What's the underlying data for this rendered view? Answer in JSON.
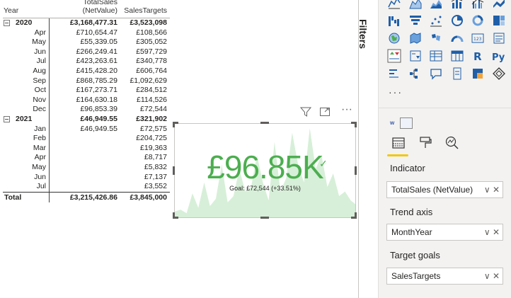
{
  "matrix": {
    "headers": [
      "Year",
      "TotalSales (NetValue)",
      "SalesTargets"
    ],
    "rows": [
      {
        "type": "year",
        "label": "2020",
        "sales": "£3,168,477.31",
        "target": "£3,523,098"
      },
      {
        "type": "month",
        "label": "Apr",
        "sales": "£710,654.47",
        "target": "£108,566"
      },
      {
        "type": "month",
        "label": "May",
        "sales": "£55,339.05",
        "target": "£305,052"
      },
      {
        "type": "month",
        "label": "Jun",
        "sales": "£266,249.41",
        "target": "£597,729"
      },
      {
        "type": "month",
        "label": "Jul",
        "sales": "£423,263.61",
        "target": "£340,778"
      },
      {
        "type": "month",
        "label": "Aug",
        "sales": "£415,428.20",
        "target": "£606,764"
      },
      {
        "type": "month",
        "label": "Sep",
        "sales": "£868,785.29",
        "target": "£1,092,629"
      },
      {
        "type": "month",
        "label": "Oct",
        "sales": "£167,273.71",
        "target": "£284,512"
      },
      {
        "type": "month",
        "label": "Nov",
        "sales": "£164,630.18",
        "target": "£114,526"
      },
      {
        "type": "month",
        "label": "Dec",
        "sales": "£96,853.39",
        "target": "£72,544"
      },
      {
        "type": "year",
        "label": "2021",
        "sales": "£46,949.55",
        "target": "£321,902"
      },
      {
        "type": "month",
        "label": "Jan",
        "sales": "£46,949.55",
        "target": "£72,575"
      },
      {
        "type": "month",
        "label": "Feb",
        "sales": "",
        "target": "£204,725"
      },
      {
        "type": "month",
        "label": "Mar",
        "sales": "",
        "target": "£19,363"
      },
      {
        "type": "month",
        "label": "Apr",
        "sales": "",
        "target": "£8,717"
      },
      {
        "type": "month",
        "label": "May",
        "sales": "",
        "target": "£5,832"
      },
      {
        "type": "month",
        "label": "Jun",
        "sales": "",
        "target": "£7,137"
      },
      {
        "type": "month",
        "label": "Jul",
        "sales": "",
        "target": "£3,552"
      }
    ],
    "total": {
      "label": "Total",
      "sales": "£3,215,426.86",
      "target": "£3,845,000"
    }
  },
  "kpi": {
    "value": "£96.85K",
    "goal": "Goal: £72,544 (+33.51%)",
    "trend": [
      8,
      10,
      6,
      28,
      12,
      40,
      14,
      22,
      60,
      18,
      25,
      55,
      30,
      35,
      70,
      40,
      20,
      85,
      30,
      45,
      95,
      60,
      40,
      100,
      55,
      70,
      35,
      50,
      25,
      30,
      20,
      15
    ],
    "accent": "#4cae4f",
    "fill": "#d7efd8"
  },
  "visual_header": {
    "filter_icon": "filter-icon",
    "focus_icon": "focus-mode-icon",
    "more_icon": "more-options-icon",
    "more_label": "···"
  },
  "filters_label": "Filters",
  "viz_pane": {
    "more_label": "···",
    "tabs": [
      "fields-tab",
      "format-tab",
      "analytics-tab"
    ],
    "r_label": "R",
    "py_label": "Py",
    "w_label": "w",
    "wells": [
      {
        "label": "Indicator",
        "value": "TotalSales (NetValue)"
      },
      {
        "label": "Trend axis",
        "value": "MonthYear"
      },
      {
        "label": "Target goals",
        "value": "SalesTargets"
      }
    ],
    "well_actions": "∨ ✕"
  }
}
